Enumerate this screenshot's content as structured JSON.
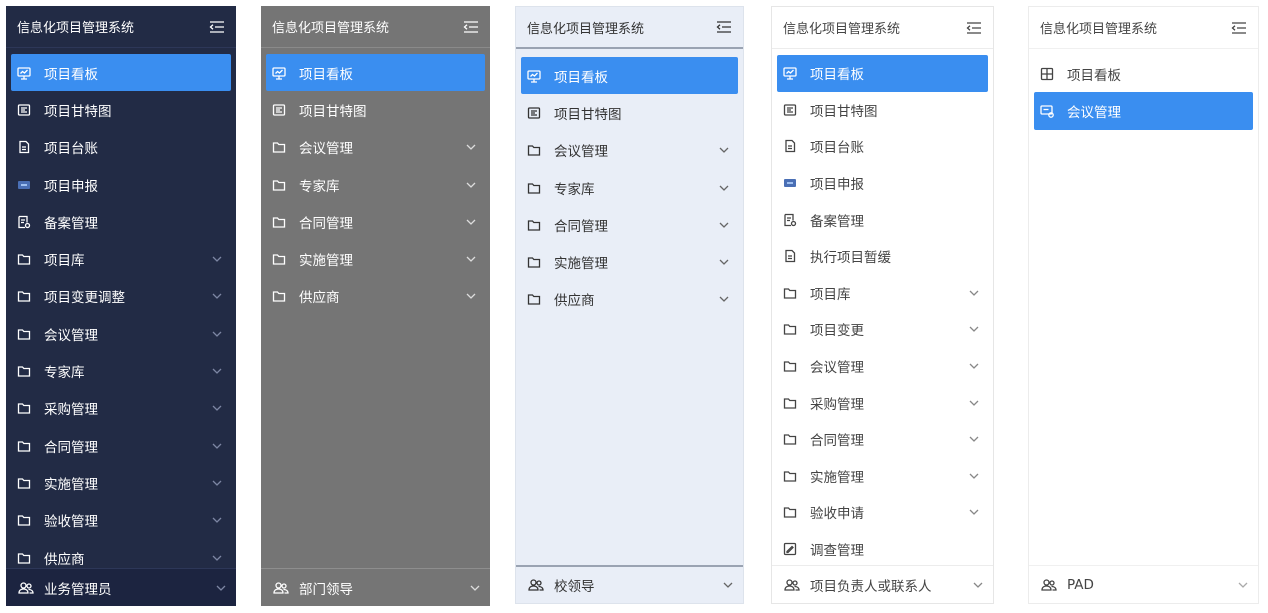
{
  "panels": [
    {
      "title": "信息化项目管理系统",
      "items": [
        {
          "label": "项目看板",
          "icon": "dashboard-icon",
          "active": true,
          "has_submenu": false
        },
        {
          "label": "项目甘特图",
          "icon": "gantt-icon",
          "active": false,
          "has_submenu": false
        },
        {
          "label": "项目台账",
          "icon": "ledger-icon",
          "active": false,
          "has_submenu": false
        },
        {
          "label": "项目申报",
          "icon": "declare-icon",
          "active": false,
          "has_submenu": false
        },
        {
          "label": "备案管理",
          "icon": "record-icon",
          "active": false,
          "has_submenu": false
        },
        {
          "label": "项目库",
          "icon": "folder-icon",
          "active": false,
          "has_submenu": true
        },
        {
          "label": "项目变更调整",
          "icon": "folder-icon",
          "active": false,
          "has_submenu": true
        },
        {
          "label": "会议管理",
          "icon": "folder-icon",
          "active": false,
          "has_submenu": true
        },
        {
          "label": "专家库",
          "icon": "folder-icon",
          "active": false,
          "has_submenu": true
        },
        {
          "label": "采购管理",
          "icon": "folder-icon",
          "active": false,
          "has_submenu": true
        },
        {
          "label": "合同管理",
          "icon": "folder-icon",
          "active": false,
          "has_submenu": true
        },
        {
          "label": "实施管理",
          "icon": "folder-icon",
          "active": false,
          "has_submenu": true
        },
        {
          "label": "验收管理",
          "icon": "folder-icon",
          "active": false,
          "has_submenu": true
        },
        {
          "label": "供应商",
          "icon": "folder-icon",
          "active": false,
          "has_submenu": true
        }
      ],
      "footer": {
        "label": "业务管理员",
        "icon": "users-icon"
      }
    },
    {
      "title": "信息化项目管理系统",
      "items": [
        {
          "label": "项目看板",
          "icon": "dashboard-icon",
          "active": true,
          "has_submenu": false
        },
        {
          "label": "项目甘特图",
          "icon": "gantt-icon",
          "active": false,
          "has_submenu": false
        },
        {
          "label": "会议管理",
          "icon": "folder-icon",
          "active": false,
          "has_submenu": true
        },
        {
          "label": "专家库",
          "icon": "folder-icon",
          "active": false,
          "has_submenu": true
        },
        {
          "label": "合同管理",
          "icon": "folder-icon",
          "active": false,
          "has_submenu": true
        },
        {
          "label": "实施管理",
          "icon": "folder-icon",
          "active": false,
          "has_submenu": true
        },
        {
          "label": "供应商",
          "icon": "folder-icon",
          "active": false,
          "has_submenu": true
        }
      ],
      "footer": {
        "label": "部门领导",
        "icon": "users-icon"
      }
    },
    {
      "title": "信息化项目管理系统",
      "items": [
        {
          "label": "项目看板",
          "icon": "dashboard-icon",
          "active": true,
          "has_submenu": false
        },
        {
          "label": "项目甘特图",
          "icon": "gantt-icon",
          "active": false,
          "has_submenu": false
        },
        {
          "label": "会议管理",
          "icon": "folder-icon",
          "active": false,
          "has_submenu": true
        },
        {
          "label": "专家库",
          "icon": "folder-icon",
          "active": false,
          "has_submenu": true
        },
        {
          "label": "合同管理",
          "icon": "folder-icon",
          "active": false,
          "has_submenu": true
        },
        {
          "label": "实施管理",
          "icon": "folder-icon",
          "active": false,
          "has_submenu": true
        },
        {
          "label": "供应商",
          "icon": "folder-icon",
          "active": false,
          "has_submenu": true
        }
      ],
      "footer": {
        "label": "校领导",
        "icon": "users-icon"
      }
    },
    {
      "title": "信息化项目管理系统",
      "items": [
        {
          "label": "项目看板",
          "icon": "dashboard-icon",
          "active": true,
          "has_submenu": false
        },
        {
          "label": "项目甘特图",
          "icon": "gantt-icon",
          "active": false,
          "has_submenu": false
        },
        {
          "label": "项目台账",
          "icon": "ledger-icon",
          "active": false,
          "has_submenu": false
        },
        {
          "label": "项目申报",
          "icon": "declare-icon",
          "active": false,
          "has_submenu": false
        },
        {
          "label": "备案管理",
          "icon": "record-icon",
          "active": false,
          "has_submenu": false
        },
        {
          "label": "执行项目暂缓",
          "icon": "ledger-icon",
          "active": false,
          "has_submenu": false
        },
        {
          "label": "项目库",
          "icon": "folder-icon",
          "active": false,
          "has_submenu": true
        },
        {
          "label": "项目变更",
          "icon": "folder-icon",
          "active": false,
          "has_submenu": true
        },
        {
          "label": "会议管理",
          "icon": "folder-icon",
          "active": false,
          "has_submenu": true
        },
        {
          "label": "采购管理",
          "icon": "folder-icon",
          "active": false,
          "has_submenu": true
        },
        {
          "label": "合同管理",
          "icon": "folder-icon",
          "active": false,
          "has_submenu": true
        },
        {
          "label": "实施管理",
          "icon": "folder-icon",
          "active": false,
          "has_submenu": true
        },
        {
          "label": "验收申请",
          "icon": "folder-icon",
          "active": false,
          "has_submenu": true
        },
        {
          "label": "调查管理",
          "icon": "survey-icon",
          "active": false,
          "has_submenu": false
        }
      ],
      "footer": {
        "label": "项目负责人或联系人",
        "icon": "users-icon"
      }
    },
    {
      "title": "信息化项目管理系统",
      "items": [
        {
          "label": "项目看板",
          "icon": "board-icon",
          "active": false,
          "has_submenu": false
        },
        {
          "label": "会议管理",
          "icon": "meeting-icon",
          "active": true,
          "has_submenu": false
        }
      ],
      "footer": {
        "label": "PAD",
        "icon": "users-icon"
      }
    }
  ],
  "colors": {
    "active_bg": "#3a8ef0",
    "panel_dark_navy": "#222b45",
    "panel_gray": "#757575",
    "panel_light_blue": "#e9eef7",
    "panel_white": "#ffffff"
  }
}
